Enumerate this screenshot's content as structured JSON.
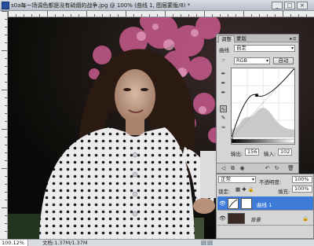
{
  "window": {
    "title": "s0a每一场调色都是没有硝烟的战争.jpg @ 100% (曲线 1, 图层蒙版/8) *",
    "minimize": "_",
    "maximize": "□",
    "close": "×"
  },
  "status": {
    "zoom": "100.12%",
    "doc_info": "文档:1.37M/1.37M",
    "prev": "◀",
    "next": "▶"
  },
  "adjust_panel": {
    "tabs": [
      "调整",
      "蒙版"
    ],
    "menu": "▸≡",
    "preset_label": "曲线",
    "preset_value": "自定",
    "channel_value": "RGB",
    "auto_button": "自动",
    "output_label": "输出:",
    "output_value": "156",
    "input_label": "输入:",
    "input_value": "102",
    "colors": {
      "curve": "#111111",
      "histogram": "#c9c9c9",
      "grid": "#cfcfcf"
    },
    "curve_points": [
      [
        0,
        0
      ],
      [
        102,
        156
      ],
      [
        255,
        255
      ]
    ],
    "footer_icons": [
      "back-arrow-icon",
      "layer-clip-icon",
      "visibility-icon",
      "previous-state-icon",
      "reset-icon",
      "trash-icon"
    ]
  },
  "layers_panel": {
    "blend_mode": "正常",
    "opacity_label": "不透明度:",
    "opacity_value": "100%",
    "lock_label": "锁定:",
    "fill_label": "填充:",
    "fill_value": "100%",
    "layers": [
      {
        "name": "曲线 1",
        "active": true
      },
      {
        "name": "背景",
        "active": false
      }
    ]
  },
  "palette": {
    "accent": "#3d7bd6",
    "panel_bg": "#d5d5d5",
    "blossom": "#c85a8e"
  }
}
